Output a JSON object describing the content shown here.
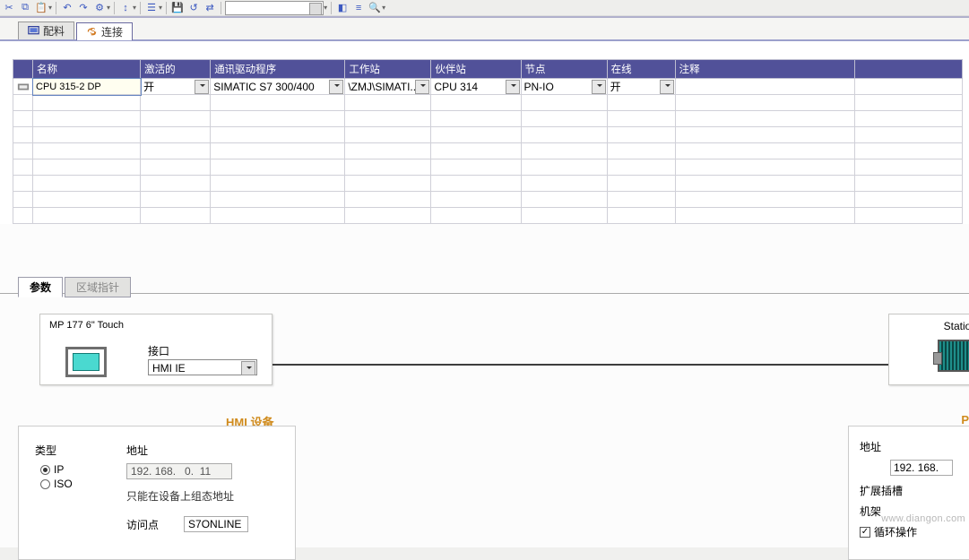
{
  "tabs": {
    "recipe": "配料",
    "connections": "连接"
  },
  "grid": {
    "headers": [
      "名称",
      "激活的",
      "通讯驱动程序",
      "工作站",
      "伙伴站",
      "节点",
      "在线",
      "注释"
    ],
    "row": {
      "name": "CPU 315-2 DP",
      "active": "开",
      "driver": "SIMATIC S7 300/400",
      "workstation": "\\ZMJ\\SIMATI...",
      "partner": "CPU 314",
      "node": "PN-IO",
      "online": "开",
      "comment": ""
    }
  },
  "propTabs": {
    "params": "参数",
    "areaPtr": "区域指针"
  },
  "diagram": {
    "hmiDevice": "MP 177 6\" Touch",
    "interfaceLabel": "接口",
    "interfaceValue": "HMI IE",
    "stationLabel": "Station"
  },
  "hmiPanel": {
    "title": "HMI 设备",
    "typeLabel": "类型",
    "ip": "IP",
    "iso": "ISO",
    "addrLabel": "地址",
    "addrValue": "192. 168.   0.  11",
    "note": "只能在设备上组态地址",
    "accessPointLabel": "访问点",
    "accessPointValue": "S7ONLINE"
  },
  "plcPanel": {
    "title": "P",
    "addrLabel": "地址",
    "addrValue": "192. 168.",
    "expansionSlot": "扩展插槽",
    "rack": "机架",
    "cyclic": "循环操作"
  },
  "watermark": "www.diangon.com"
}
